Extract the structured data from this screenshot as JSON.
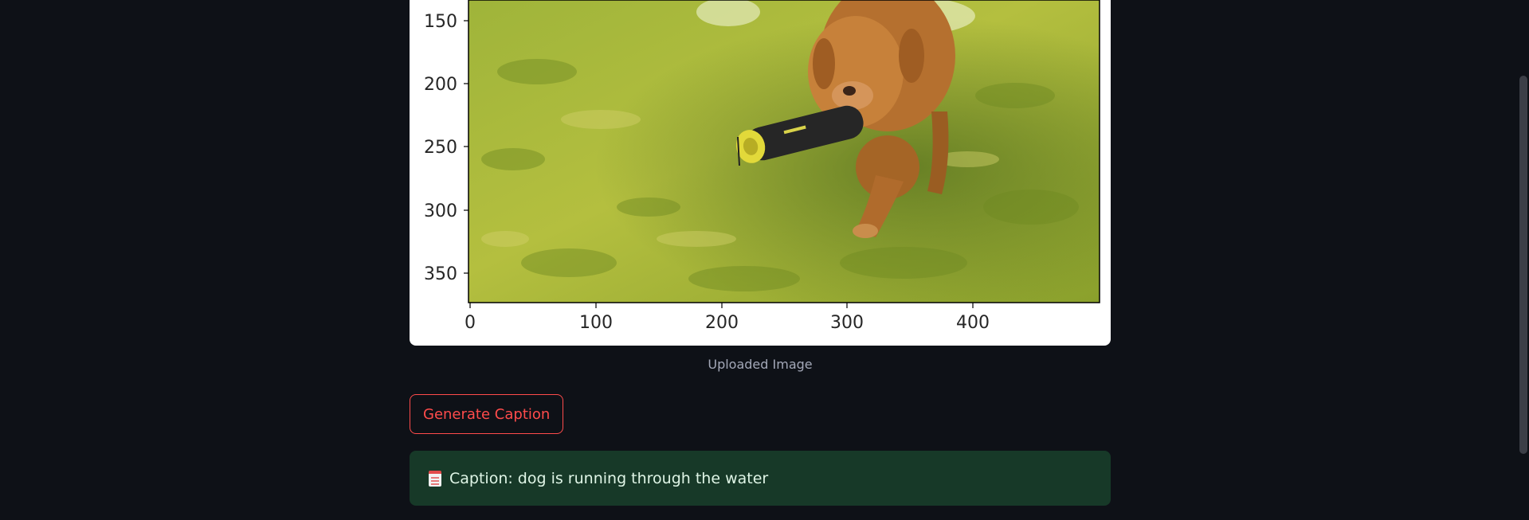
{
  "figure": {
    "alt": "dog carrying a black and yellow toy while running through shallow green water",
    "y_ticks": [
      "150",
      "200",
      "250",
      "300",
      "350"
    ],
    "x_ticks": [
      "0",
      "100",
      "200",
      "300",
      "400"
    ]
  },
  "caption_label": "Uploaded Image",
  "generate_button": {
    "label": "Generate Caption"
  },
  "result": {
    "icon": "memo-icon",
    "text": "Caption: dog is running through the water"
  },
  "colors": {
    "background": "#0e1117",
    "accent": "#ff4b4b",
    "success_bg": "#173928"
  }
}
